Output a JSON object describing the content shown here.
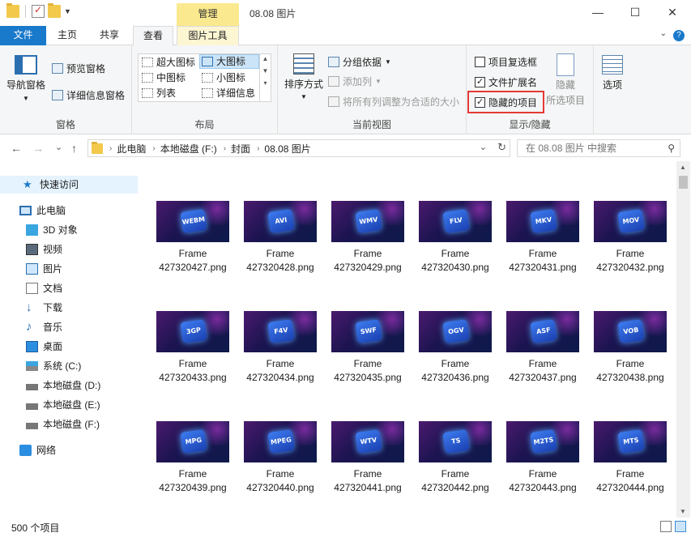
{
  "window": {
    "context_tab": "管理",
    "title": "08.08 图片",
    "minimize": "—",
    "maximize": "☐",
    "close": "✕"
  },
  "tabs": {
    "file": "文件",
    "home": "主页",
    "share": "共享",
    "view": "查看",
    "picture_tools": "图片工具"
  },
  "ribbon": {
    "panes": {
      "nav_pane": "导航窗格",
      "preview_pane": "预览窗格",
      "details_pane": "详细信息窗格",
      "label": "窗格"
    },
    "layout": {
      "extra_large": "超大图标",
      "large": "大图标",
      "medium": "中图标",
      "small": "小图标",
      "list": "列表",
      "details": "详细信息",
      "label": "布局"
    },
    "current_view": {
      "sort_by": "排序方式",
      "group_by": "分组依据",
      "add_columns": "添加列",
      "size_columns": "将所有列调整为合适的大小",
      "label": "当前视图"
    },
    "show_hide": {
      "item_checkboxes": "项目复选框",
      "file_extensions": "文件扩展名",
      "hidden_items": "隐藏的项目",
      "hide_selected_1": "隐藏",
      "hide_selected_2": "所选项目",
      "label": "显示/隐藏",
      "checkbox_states": {
        "item_checkboxes": false,
        "file_extensions": true,
        "hidden_items": true
      }
    },
    "options": "选项"
  },
  "address": {
    "back": "←",
    "forward": "→",
    "recent": "⌄",
    "up": "↑",
    "crumbs": [
      "此电脑",
      "本地磁盘 (F:)",
      "封面",
      "08.08 图片"
    ],
    "search_placeholder": "在 08.08 图片 中搜索"
  },
  "sidebar": {
    "quick_access": "快速访问",
    "this_pc": "此电脑",
    "items": [
      "3D 对象",
      "视频",
      "图片",
      "文档",
      "下载",
      "音乐",
      "桌面",
      "系统 (C:)",
      "本地磁盘 (D:)",
      "本地磁盘 (E:)",
      "本地磁盘 (F:)"
    ],
    "network": "网络"
  },
  "files": [
    {
      "badge": "WEBM",
      "line1": "Frame",
      "line2": "427320427.png"
    },
    {
      "badge": "AVI",
      "line1": "Frame",
      "line2": "427320428.png"
    },
    {
      "badge": "WMV",
      "line1": "Frame",
      "line2": "427320429.png"
    },
    {
      "badge": "FLV",
      "line1": "Frame",
      "line2": "427320430.png"
    },
    {
      "badge": "MKV",
      "line1": "Frame",
      "line2": "427320431.png"
    },
    {
      "badge": "MOV",
      "line1": "Frame",
      "line2": "427320432.png"
    },
    {
      "badge": "3GP",
      "line1": "Frame",
      "line2": "427320433.png"
    },
    {
      "badge": "F4V",
      "line1": "Frame",
      "line2": "427320434.png"
    },
    {
      "badge": "SWF",
      "line1": "Frame",
      "line2": "427320435.png"
    },
    {
      "badge": "OGV",
      "line1": "Frame",
      "line2": "427320436.png"
    },
    {
      "badge": "ASF",
      "line1": "Frame",
      "line2": "427320437.png"
    },
    {
      "badge": "VOB",
      "line1": "Frame",
      "line2": "427320438.png"
    },
    {
      "badge": "MPG",
      "line1": "Frame",
      "line2": "427320439.png"
    },
    {
      "badge": "MPEG",
      "line1": "Frame",
      "line2": "427320440.png"
    },
    {
      "badge": "WTV",
      "line1": "Frame",
      "line2": "427320441.png"
    },
    {
      "badge": "TS",
      "line1": "Frame",
      "line2": "427320442.png"
    },
    {
      "badge": "M2TS",
      "line1": "Frame",
      "line2": "427320443.png"
    },
    {
      "badge": "MTS",
      "line1": "Frame",
      "line2": "427320444.png"
    }
  ],
  "status": {
    "count": "500 个项目"
  },
  "colors": {
    "accent": "#1979ca",
    "highlight_border": "#e53935",
    "context_tab": "#fbe98f"
  }
}
